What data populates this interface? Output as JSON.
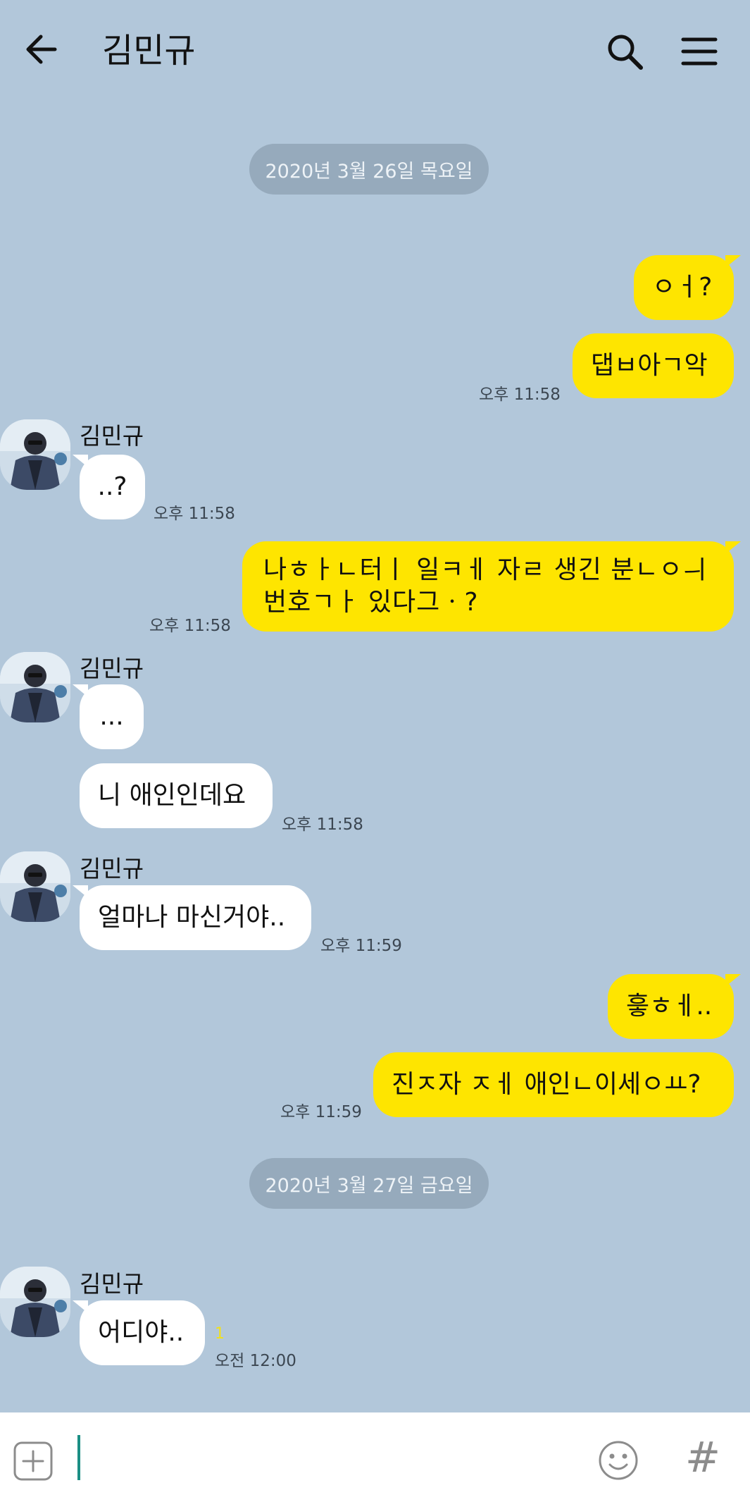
{
  "header": {
    "title": "김민규"
  },
  "icons": {
    "back": "arrow-left-icon",
    "search": "search-icon",
    "menu": "hamburger-menu-icon",
    "add": "plus-square-icon",
    "emoji": "smiley-icon",
    "hash": "#"
  },
  "colors": {
    "background": "#b2c7da",
    "my_bubble": "#fee500",
    "their_bubble": "#ffffff"
  },
  "dates": [
    "2020년 3월 26일 목요일",
    "2020년 3월 27일 금요일"
  ],
  "messages": [
    {
      "from": "me",
      "text": "ㅇㅓ?"
    },
    {
      "from": "me",
      "text": "댑ㅂ아ㄱ악",
      "time": "오후 11:58"
    },
    {
      "from": "김민규",
      "sender": "김민규",
      "text": "..?",
      "time": "오후 11:58"
    },
    {
      "from": "me",
      "text": "나ㅎㅏㄴ터ㅣ 일ㅋㅔ 자ㄹ 생긴 분ㄴㅇㅢ 번호ㄱㅏ 있다그ㆍ?",
      "time": "오후 11:58"
    },
    {
      "from": "김민규",
      "sender": "김민규",
      "text": "..."
    },
    {
      "from": "김민규",
      "text": "니 애인인데요",
      "time": "오후 11:58"
    },
    {
      "from": "김민규",
      "sender": "김민규",
      "text": "얼마나 마신거야..",
      "time": "오후 11:59"
    },
    {
      "from": "me",
      "text": "흫ㅎㅔ.."
    },
    {
      "from": "me",
      "text": "진ㅈ자 ㅈㅔ 애인ㄴ이세ㅇㅛ?",
      "time": "오후 11:59"
    },
    {
      "from": "김민규",
      "sender": "김민규",
      "text": "어디야..",
      "time": "오전 12:00",
      "unread": "1"
    }
  ]
}
